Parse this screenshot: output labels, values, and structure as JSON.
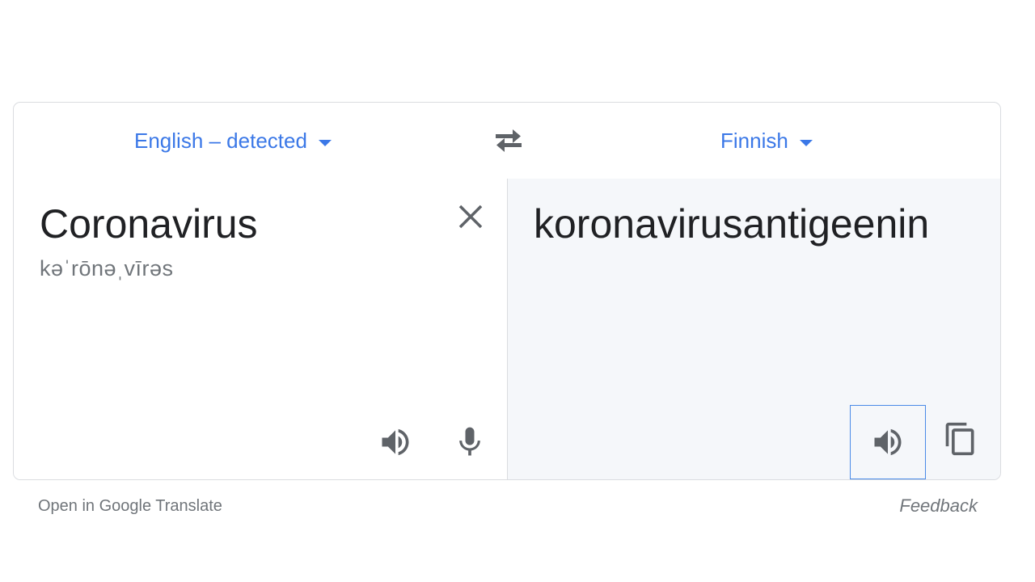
{
  "language_bar": {
    "source_language": "English – detected",
    "target_language": "Finnish",
    "swap_icon": "swap-arrows-icon"
  },
  "source": {
    "text": "Coronavirus",
    "phonetic": "kəˈrōnəˌvīrəs",
    "clear_icon": "close-icon",
    "listen_icon": "speaker-icon",
    "mic_icon": "microphone-icon"
  },
  "target": {
    "text": "koronavirusantigeenin",
    "listen_icon": "speaker-icon",
    "copy_icon": "copy-icon"
  },
  "footer": {
    "open_link": "Open in Google Translate",
    "feedback_link": "Feedback"
  },
  "colors": {
    "accent": "#3b78e7",
    "border": "#dadce0",
    "text_primary": "#202124",
    "text_secondary": "#70757a",
    "icon": "#5f6368",
    "target_panel_bg": "#f5f7fa",
    "focus_border": "#4a8ae8"
  }
}
